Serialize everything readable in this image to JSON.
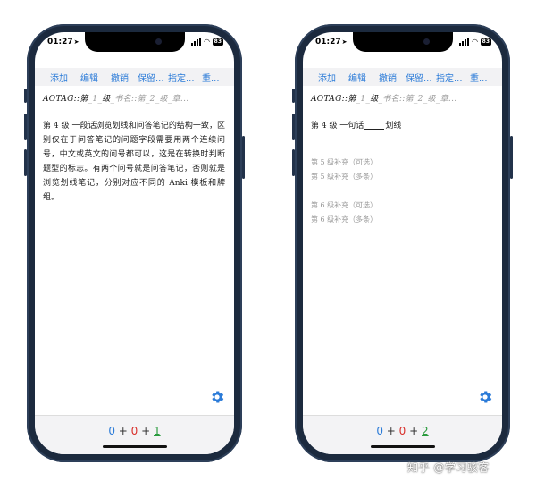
{
  "status": {
    "time": "01:27",
    "battery": "83"
  },
  "toolbar": [
    "添加",
    "编辑",
    "撤销",
    "保留...",
    "指定...",
    "重..."
  ],
  "tag": {
    "a": "AOTAG::第",
    "b": "_1_",
    "c": "级",
    "d": "_书名::第",
    "e": "_2_",
    "f": "级",
    "g": "_章..."
  },
  "left_card": {
    "text": "第 4 级 一段话浏览划线和问答笔记的结构一致，区别仅在于问答笔记的问题字段需要用两个连续问号，中文或英文的问号都可以，这是在转换时判断题型的标志。有两个问号就是问答笔记，否则就是浏览划线笔记，分别对应不同的 Anki 模板和牌组。"
  },
  "right_card": {
    "line_prefix": "第 4 级 一句话",
    "line_suffix": "划线",
    "sup5a": "第 5 级补充（可选）",
    "sup5b": "第 5 级补充（多条）",
    "sup6a": "第 6 级补充（可选）",
    "sup6b": "第 6 级补充（多条）"
  },
  "counts_left": {
    "new": "0",
    "learn": "0",
    "review": "1"
  },
  "counts_right": {
    "new": "0",
    "learn": "0",
    "review": "2"
  },
  "icons": {
    "settings": "gear-icon"
  },
  "colors": {
    "accent": "#2b7bd8",
    "red": "#d9302c",
    "green": "#2a9b3e"
  },
  "watermark": "知乎 @学习骇客"
}
